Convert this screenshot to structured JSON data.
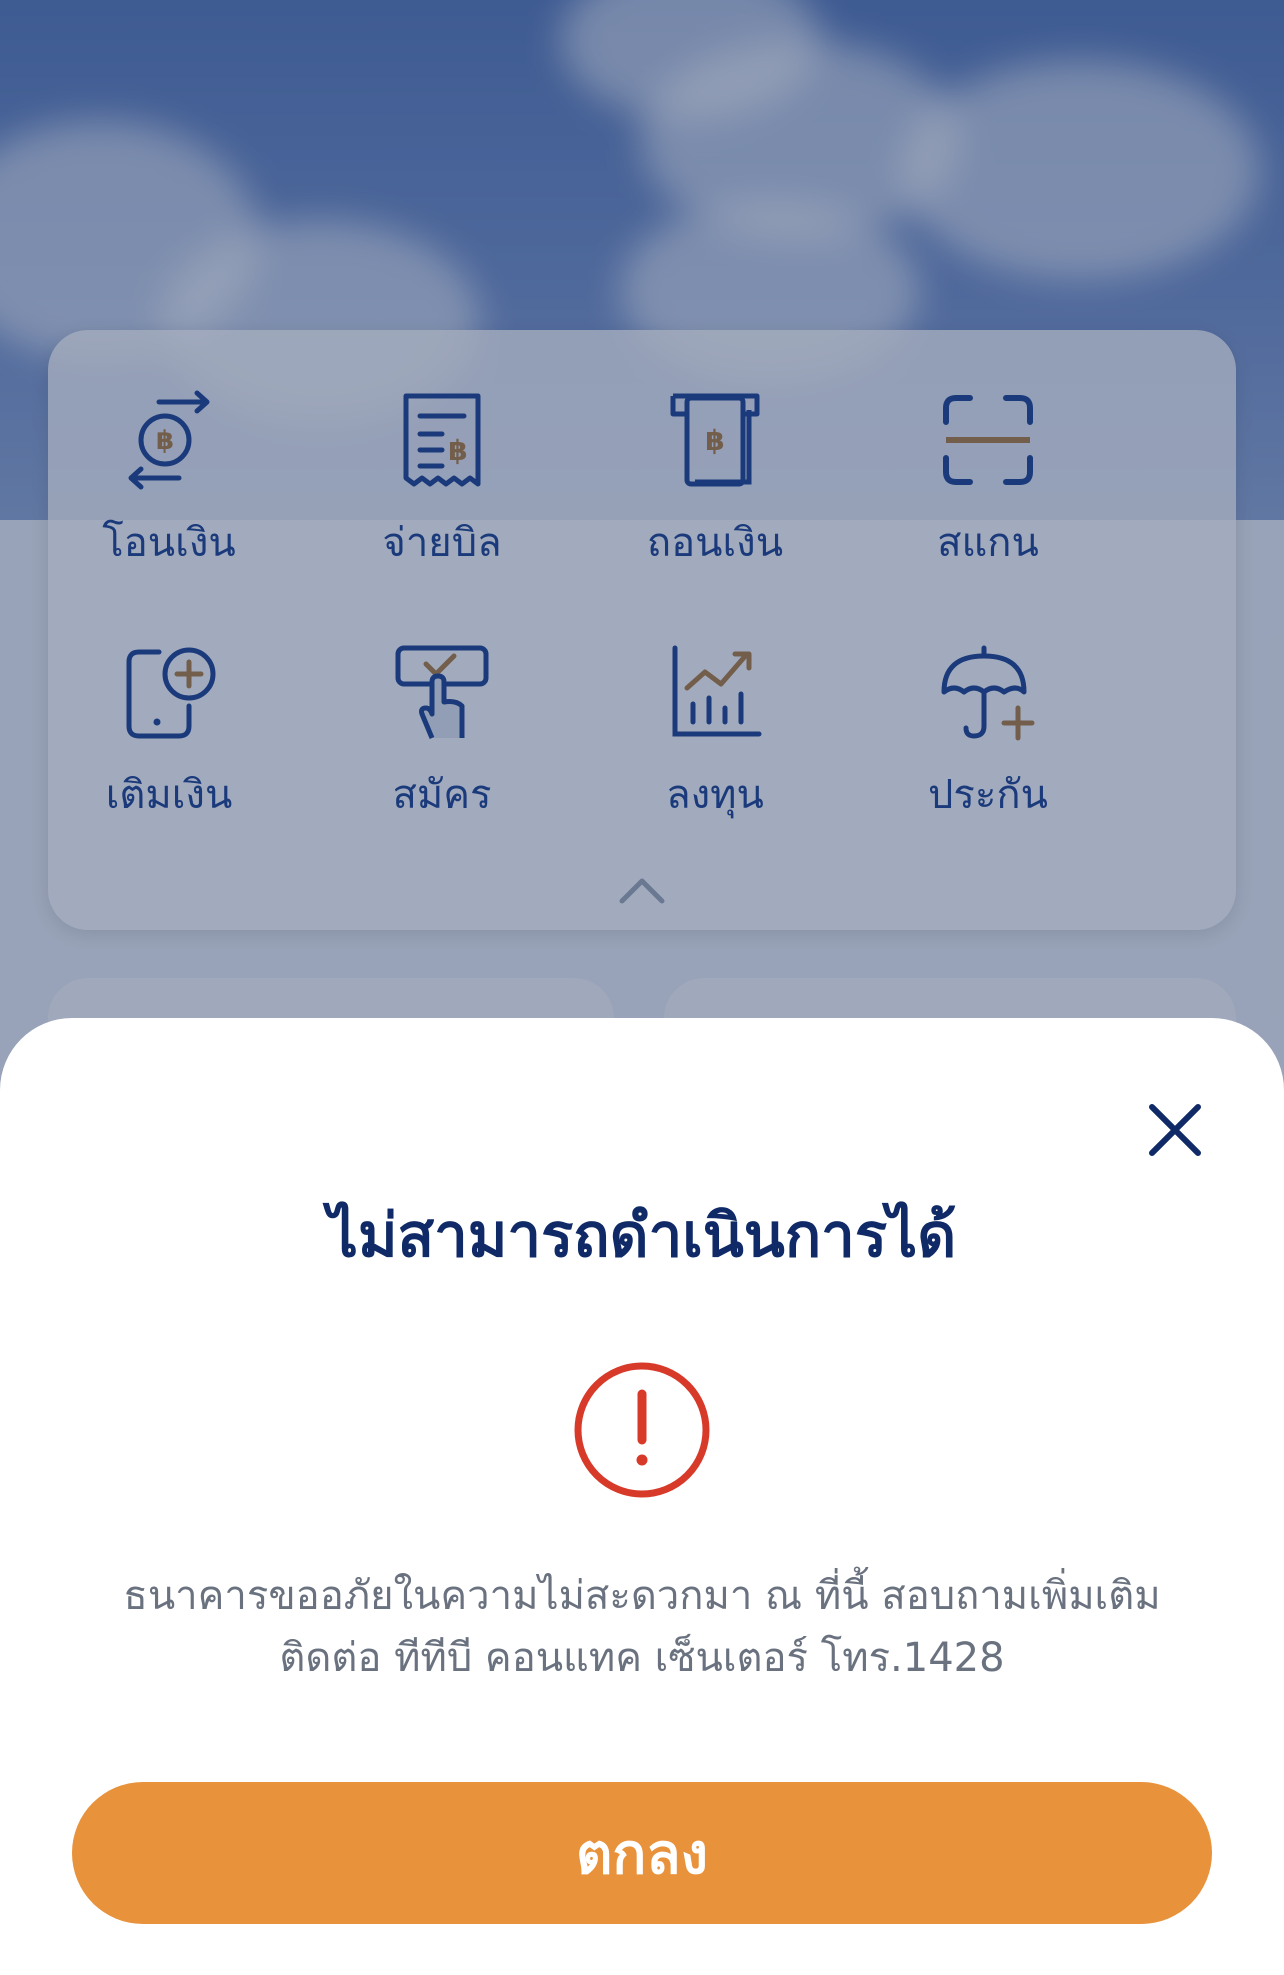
{
  "menu": {
    "items": [
      {
        "label": "โอนเงิน",
        "icon": "transfer-icon"
      },
      {
        "label": "จ่ายบิล",
        "icon": "bill-payment-icon"
      },
      {
        "label": "ถอนเงิน",
        "icon": "withdraw-icon"
      },
      {
        "label": "สแกน",
        "icon": "scan-icon"
      },
      {
        "label": "เติมเงิน",
        "icon": "top-up-icon"
      },
      {
        "label": "สมัคร",
        "icon": "apply-icon"
      },
      {
        "label": "ลงทุน",
        "icon": "invest-icon"
      },
      {
        "label": "ประกัน",
        "icon": "insurance-icon"
      }
    ],
    "collapse_icon": "chevron-up-icon"
  },
  "dialog": {
    "title": "ไม่สามารถดำเนินการได้",
    "icon": "alert-icon",
    "message_line1": "ธนาคารขออภัยในความไม่สะดวกมา ณ ที่นี้ สอบถามเพิ่มเติม",
    "message_line2": "ติดต่อ ทีทีบี คอนแทค เซ็นเตอร์ โทร.1428",
    "ok_label": "ตกลง",
    "close_icon": "close-icon"
  },
  "colors": {
    "primary_blue": "#123a8c",
    "accent_orange": "#e8923c",
    "alert_red": "#d83a2a",
    "icon_gold": "#a8773a"
  }
}
